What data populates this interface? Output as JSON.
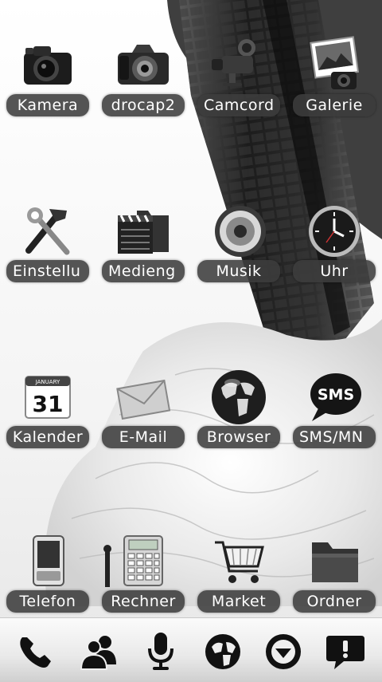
{
  "home_screen": {
    "rows": [
      [
        {
          "label": "Kamera",
          "icon": "camera-icon"
        },
        {
          "label": "drocap2",
          "icon": "dslr-camera-icon"
        },
        {
          "label": "Camcord",
          "icon": "camcorder-icon"
        },
        {
          "label": "Galerie",
          "icon": "gallery-icon"
        }
      ],
      [
        {
          "label": "Einstellu",
          "icon": "settings-tools-icon"
        },
        {
          "label": "Medieng",
          "icon": "media-folder-icon"
        },
        {
          "label": "Musik",
          "icon": "speaker-icon"
        },
        {
          "label": "Uhr",
          "icon": "clock-icon"
        }
      ],
      [
        {
          "label": "Kalender",
          "icon": "calendar-icon",
          "calendar_month": "JANUARY",
          "calendar_day": "31"
        },
        {
          "label": "E-Mail",
          "icon": "envelope-icon"
        },
        {
          "label": "Browser",
          "icon": "globe-icon"
        },
        {
          "label": "SMS/MN",
          "icon": "sms-bubble-icon",
          "bubble_text": "SMS"
        }
      ],
      [
        {
          "label": "Telefon",
          "icon": "phone-device-icon"
        },
        {
          "label": "Rechner",
          "icon": "calculator-icon"
        },
        {
          "label": "Market",
          "icon": "shopping-cart-icon"
        },
        {
          "label": "Ordner",
          "icon": "folder-icon"
        }
      ]
    ]
  },
  "dock": {
    "items": [
      {
        "name": "phone",
        "icon": "phone-handset-icon"
      },
      {
        "name": "contacts",
        "icon": "contacts-icon"
      },
      {
        "name": "voice",
        "icon": "microphone-icon"
      },
      {
        "name": "browser",
        "icon": "globe-icon"
      },
      {
        "name": "app-drawer",
        "icon": "app-drawer-icon"
      },
      {
        "name": "messages",
        "icon": "message-alert-icon"
      }
    ]
  }
}
